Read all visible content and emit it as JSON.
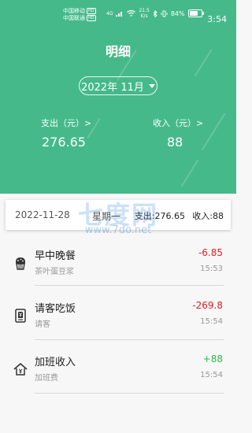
{
  "status_bar": {
    "carrier1": "中国移动",
    "carrier2": "中国联通",
    "hd": "HD",
    "network": "4G",
    "speed_value": "21.5",
    "speed_unit": "K/s",
    "battery": "84%",
    "battery_level": 0.84,
    "time": "3:54"
  },
  "header": {
    "title": "明细",
    "date_selector": "2022年 11月"
  },
  "summary": {
    "expense_label": "支出（元）>",
    "expense_value": "276.65",
    "income_label": "收入（元）>",
    "income_value": "88"
  },
  "watermark": {
    "cn": "七度网",
    "url": "www.7do.net"
  },
  "day_group": {
    "date": "2022-11-28",
    "weekday": "星期一",
    "expense": "支出:276.65",
    "income": "收入:88"
  },
  "records": [
    {
      "icon": "cake-icon",
      "name": "早中晚餐",
      "note": "茶叶蛋豆浆",
      "amount": "-6.85",
      "time": "15:53",
      "type": "expense"
    },
    {
      "icon": "wallet-icon",
      "name": "请客吃饭",
      "note": "请客",
      "amount": "-269.8",
      "time": "15:54",
      "type": "expense"
    },
    {
      "icon": "house-money-icon",
      "name": "加班收入",
      "note": "加班费",
      "amount": "+88",
      "time": "15:54",
      "type": "income"
    }
  ],
  "colors": {
    "header_bg": "#46b98a",
    "expense": "#e02020",
    "income": "#2db84a"
  }
}
